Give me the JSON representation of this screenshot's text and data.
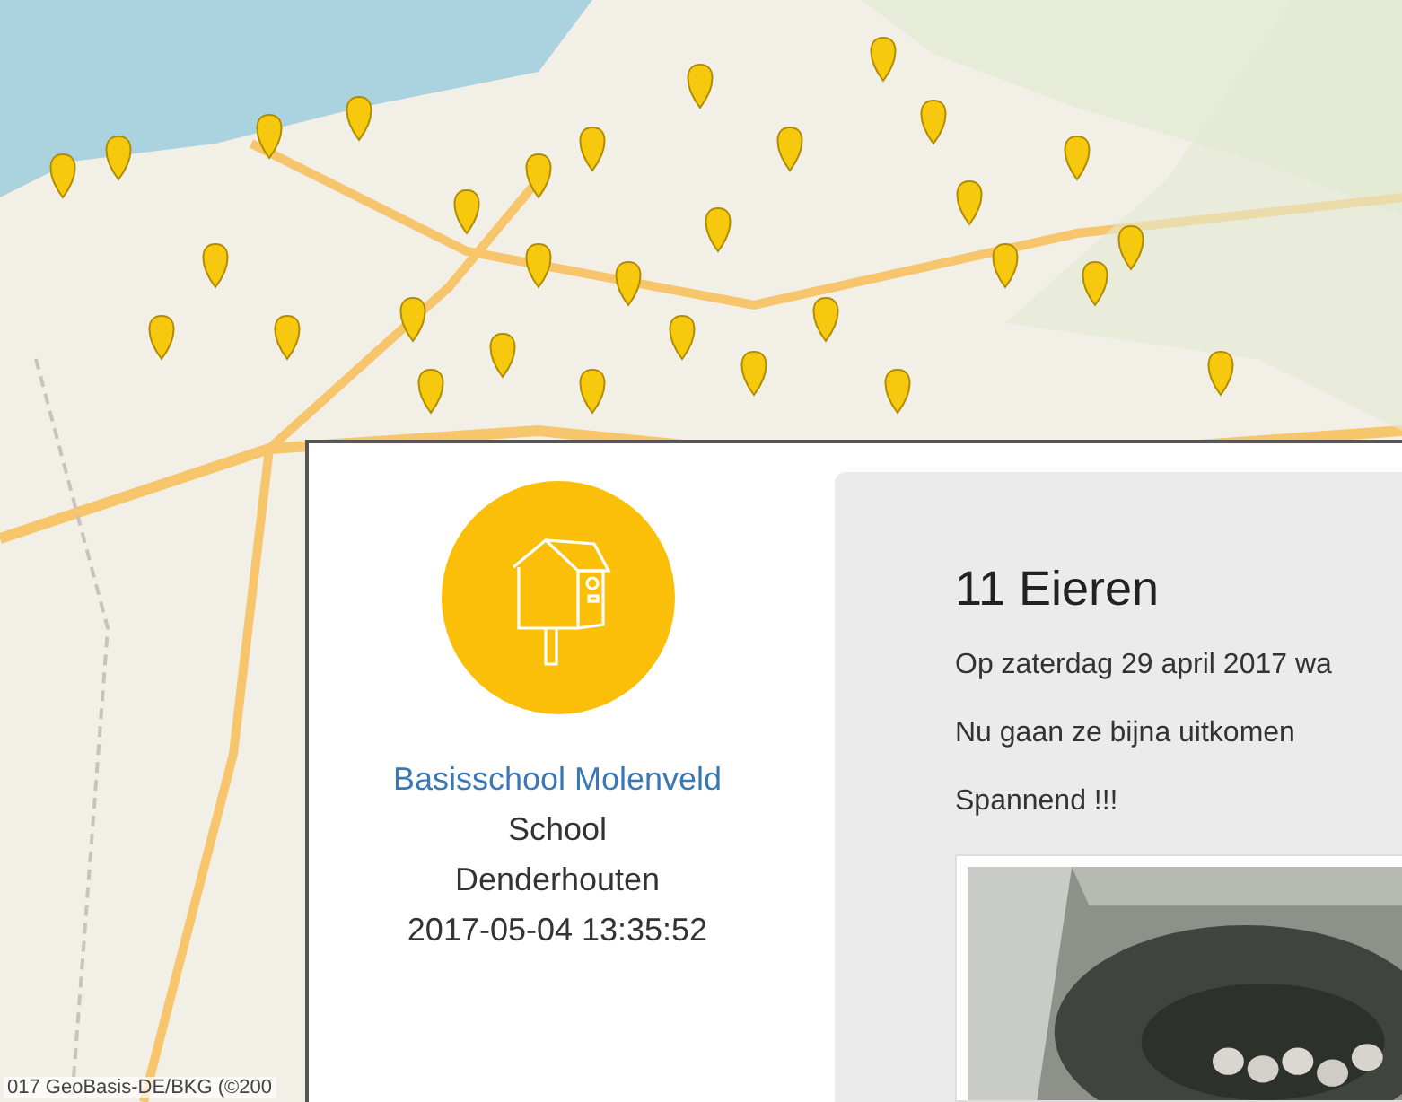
{
  "map": {
    "kind": "picture",
    "attribution": "017 GeoBasis-DE/BKG (©200"
  },
  "popup": {
    "name": "Basisschool Molenveld",
    "type": "School",
    "location": "Denderhouten",
    "timestamp": "2017-05-04 13:35:52",
    "post": {
      "title": "11 Eieren",
      "paragraphs": [
        "Op zaterdag 29 april 2017 wa",
        "Nu gaan ze bijna uitkomen",
        "Spannend !!!"
      ]
    }
  }
}
